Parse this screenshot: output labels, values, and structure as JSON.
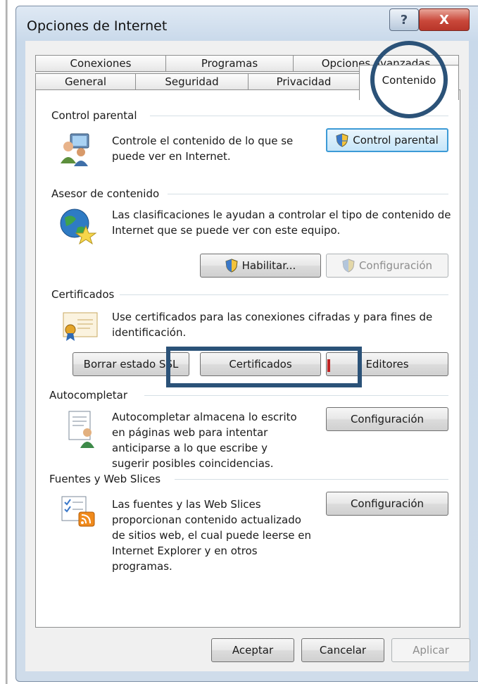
{
  "window": {
    "title": "Opciones de Internet",
    "help_label": "?",
    "close_label": "X"
  },
  "tabs": {
    "row_back": [
      "Conexiones",
      "Programas",
      "Opciones avanzadas"
    ],
    "row_front": [
      "General",
      "Seguridad",
      "Privacidad",
      "Contenido"
    ],
    "active": "Contenido"
  },
  "control_parental": {
    "title": "Control parental",
    "description": [
      "Controle el contenido de lo que se",
      "puede ver en Internet."
    ],
    "button_label": "Control parental"
  },
  "asesor": {
    "title": "Asesor de contenido",
    "description": [
      "Las clasificaciones le ayudan a controlar el tipo de contenido de",
      "Internet que se puede ver con este equipo."
    ],
    "enable_label": "Habilitar...",
    "config_label": "Configuración"
  },
  "certificados": {
    "title": "Certificados",
    "description": [
      "Use certificados para las conexiones cifradas y para fines de",
      "identificación."
    ],
    "clear_ssl_label": "Borrar estado SSL",
    "certs_label": "Certificados",
    "publishers_label": "Editores"
  },
  "autocompletar": {
    "title": "Autocompletar",
    "description": [
      "Autocompletar almacena lo escrito",
      "en páginas web para intentar",
      "anticiparse a lo que escribe y",
      "sugerir posibles coincidencias."
    ],
    "config_label": "Configuración"
  },
  "fuentes": {
    "title": "Fuentes y Web Slices",
    "description": [
      "Las fuentes y las Web Slices",
      "proporcionan contenido actualizado",
      "de sitios web, el cual puede leerse en",
      "Internet Explorer y en otros",
      "programas."
    ],
    "config_label": "Configuración"
  },
  "footer": {
    "accept_label": "Aceptar",
    "cancel_label": "Cancelar",
    "apply_label": "Aplicar"
  },
  "colors": {
    "annotation": "#2b5278",
    "focus_border": "#3c9ad6"
  },
  "icons": [
    "parental-users-icon",
    "content-advisor-globe-icon",
    "certificate-icon",
    "autocomplete-document-icon",
    "feeds-rss-icon",
    "uac-shield-icon"
  ]
}
